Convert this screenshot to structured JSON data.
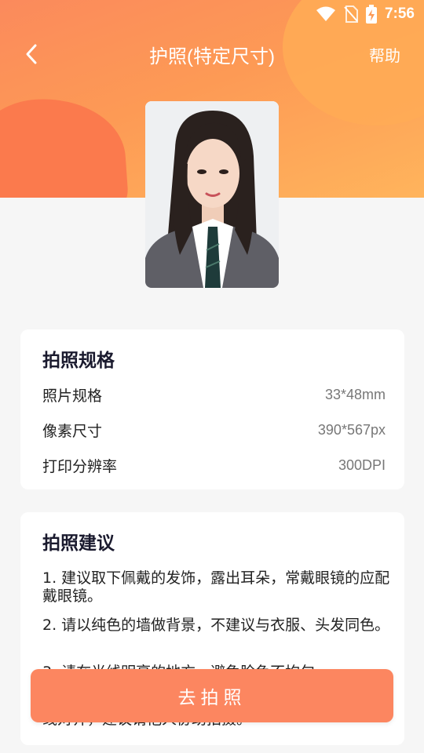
{
  "status_bar": {
    "time": "7:56"
  },
  "nav": {
    "title": "护照(特定尺寸)",
    "help_label": "帮助"
  },
  "spec_card": {
    "title": "拍照规格",
    "rows": [
      {
        "label": "照片规格",
        "value": "33*48mm"
      },
      {
        "label": "像素尺寸",
        "value": "390*567px"
      },
      {
        "label": "打印分辨率",
        "value": "300DPI"
      }
    ]
  },
  "advice_card": {
    "title": "拍照建议",
    "items": [
      "1. 建议取下佩戴的发饰，露出耳朵，常戴眼镜的应配戴眼镜。",
      "2. 请以纯色的墙做背景，不建议与衣服、头发同色。",
      "3. 请在光线明亮的地方，避免脸色不均匀，",
      "线对齐，建议请他人协助拍摄。"
    ]
  },
  "cta": {
    "label": "去拍照"
  },
  "colors": {
    "accent": "#fc8660",
    "header_orange": "#fd9a55"
  }
}
